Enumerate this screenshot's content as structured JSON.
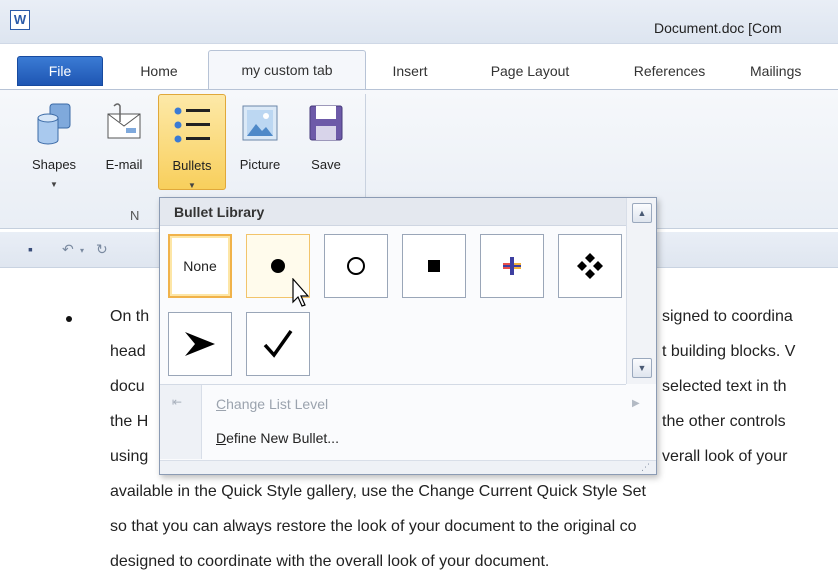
{
  "window": {
    "app_icon": "W",
    "title": "Document.doc [Com"
  },
  "tabs": [
    {
      "label": "File"
    },
    {
      "label": "Home"
    },
    {
      "label": "my custom tab"
    },
    {
      "label": "Insert"
    },
    {
      "label": "Page Layout"
    },
    {
      "label": "References"
    },
    {
      "label": "Mailings"
    }
  ],
  "ribbon": {
    "buttons": [
      {
        "label": "Shapes",
        "icon": "shapes-icon"
      },
      {
        "label": "E-mail",
        "icon": "email-icon"
      },
      {
        "label": "Bullets",
        "icon": "bullets-icon"
      },
      {
        "label": "Picture",
        "icon": "picture-icon"
      },
      {
        "label": "Save",
        "icon": "save-icon"
      }
    ],
    "group_label": "N"
  },
  "quick_access": [
    "save-icon",
    "undo-icon",
    "redo-icon"
  ],
  "bullet_menu": {
    "title": "Bullet Library",
    "none_label": "None",
    "items": [
      {
        "label_underline": "C",
        "label_rest": "hange List Level",
        "disabled": true
      },
      {
        "label_underline": "D",
        "label_rest": "efine New Bullet...",
        "disabled": false
      }
    ]
  },
  "document": {
    "lines": [
      "On th",
      "head",
      "docu",
      "the H",
      "using",
      "available in the Quick Style gallery, use the Change Current Quick Style Set",
      "so that you can always restore the look of your document to the original co",
      "designed to coordinate with the overall look of your document."
    ],
    "right_fragments": [
      "signed to coordina",
      "t building blocks. V",
      "selected text in th",
      "the other controls",
      "verall look of your"
    ]
  },
  "colors": {
    "accent": "#1e56b3",
    "highlight": "#f8cf5c"
  }
}
